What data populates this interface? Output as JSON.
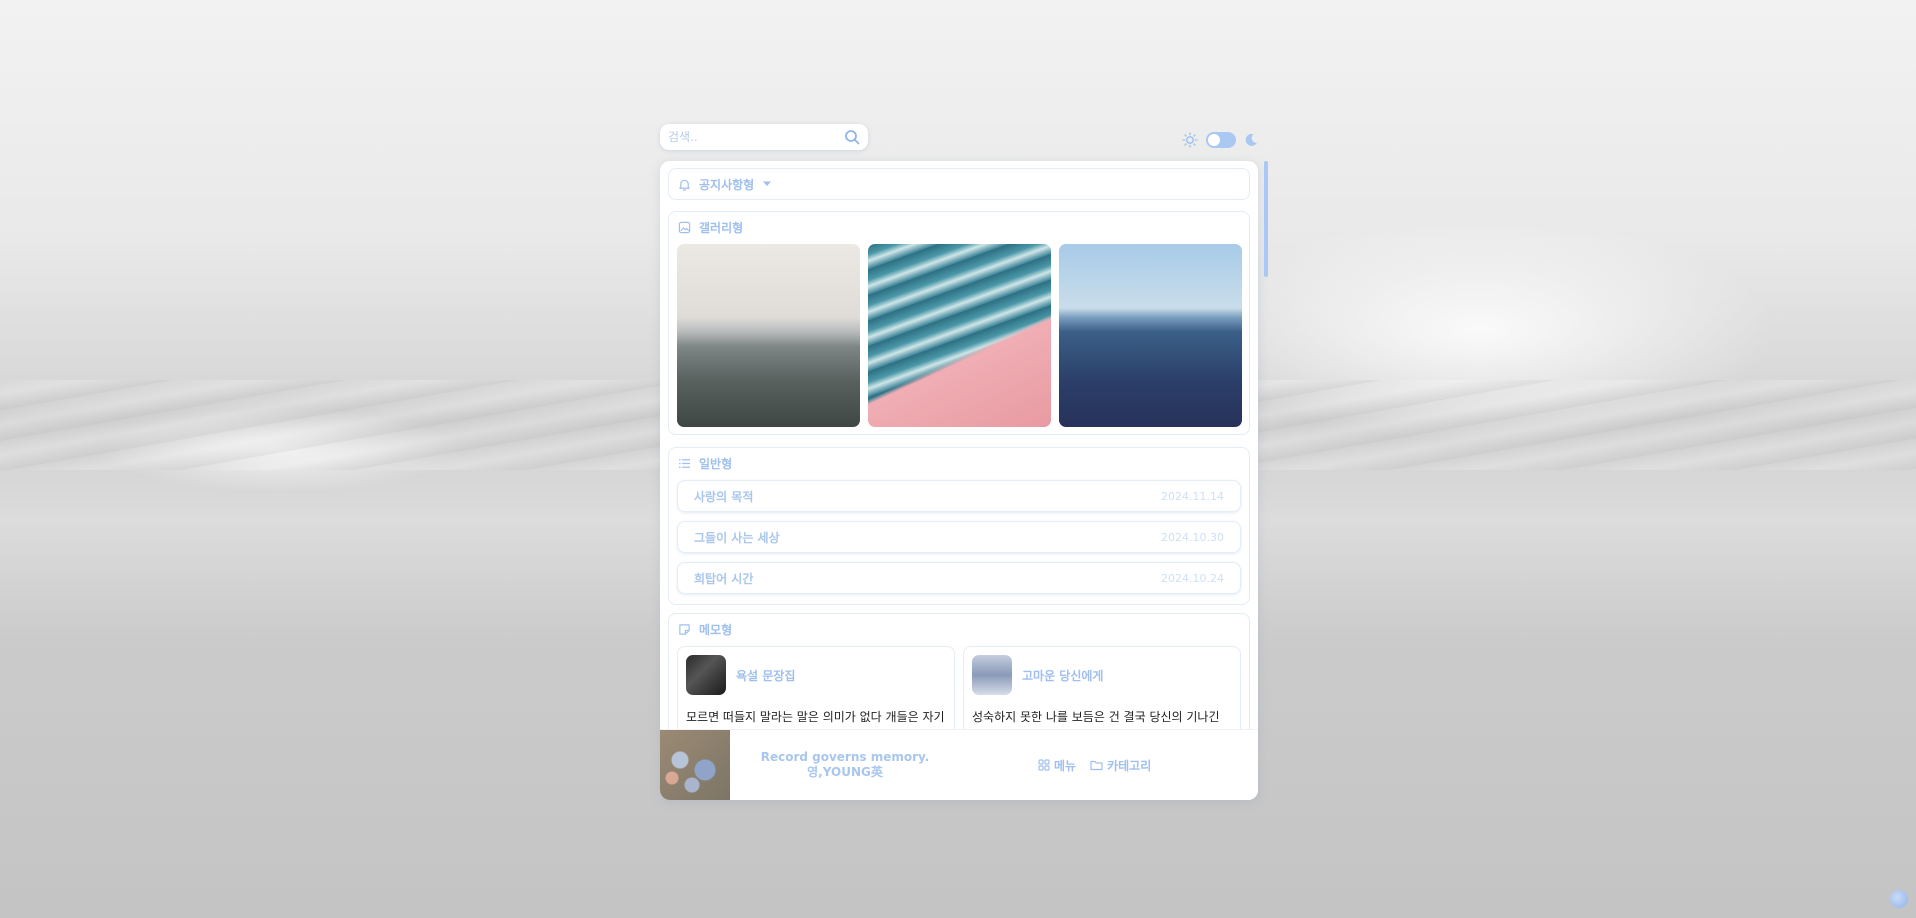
{
  "search": {
    "placeholder": "검색.."
  },
  "sections": {
    "notice": {
      "label": "공지사항형"
    },
    "gallery": {
      "label": "갤러리형"
    },
    "general": {
      "label": "일반형",
      "items": [
        {
          "title": "사랑의 목적",
          "date": "2024.11.14"
        },
        {
          "title": "그들이 사는 세상",
          "date": "2024.10.30"
        },
        {
          "title": "희탑어 시간",
          "date": "2024.10.24"
        }
      ]
    },
    "memo": {
      "label": "메모형",
      "cards": [
        {
          "title": "욕설 문장집",
          "text": "모르면 떠들지 말라는 말은 의미가 없다 개들은 자기가 뭘 모르는지도 모르고 신나게 떠들어대는 것이 얼마나"
        },
        {
          "title": "고마운 당신에게",
          "text": "성숙하지 못한 나를 보듬은 건 결국 당신의 기나긴 노력이었고 나는 그걸 모르고 살았다 늦었지만 고마웠다"
        }
      ]
    }
  },
  "footer": {
    "motto_line1": "Record governs memory.",
    "motto_line2": "영,YOUNG英",
    "menu_label": "메뉴",
    "category_label": "카테고리"
  },
  "colors": {
    "accent": "#9fc0ee",
    "accent_light": "#cfe0f5"
  },
  "icons": [
    "search-icon",
    "sun-icon",
    "moon-icon",
    "bell-icon",
    "image-icon",
    "list-icon",
    "memo-icon",
    "grid-icon",
    "folder-icon",
    "chevron-down-icon"
  ]
}
